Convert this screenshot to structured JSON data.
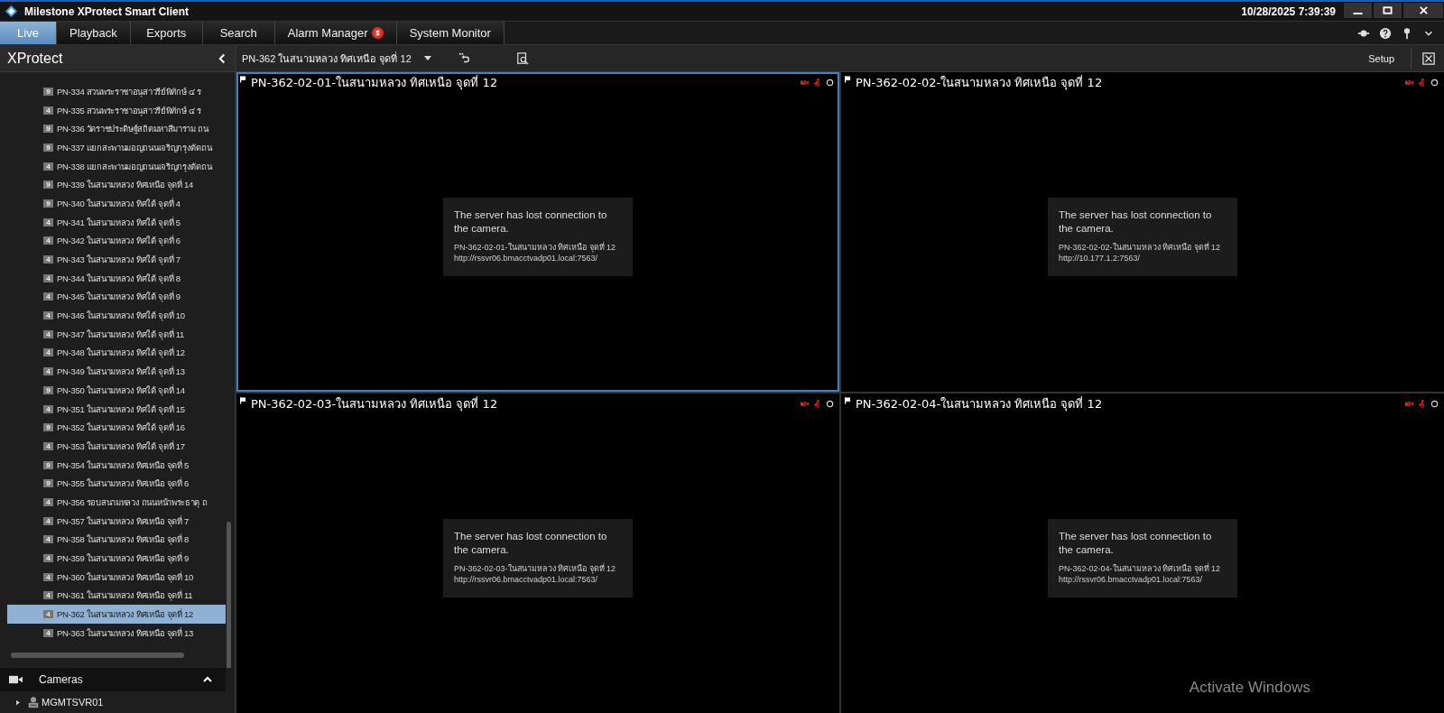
{
  "window": {
    "title": "Milestone XProtect Smart Client",
    "clock": "10/28/2025 7:39:39"
  },
  "tabs": [
    {
      "label": "Live",
      "selected": true,
      "alert": false
    },
    {
      "label": "Playback",
      "selected": false,
      "alert": false
    },
    {
      "label": "Exports",
      "selected": false,
      "alert": false
    },
    {
      "label": "Search",
      "selected": false,
      "alert": false
    },
    {
      "label": "Alarm Manager",
      "selected": false,
      "alert": true
    },
    {
      "label": "System Monitor",
      "selected": false,
      "alert": false
    }
  ],
  "sidebar": {
    "title": "XProtect",
    "items": [
      {
        "badge": "9",
        "label": "PN-334 สวนพระราชาอนุสาวรีย์พิทักษ์ ๔ ร",
        "selected": false
      },
      {
        "badge": "4",
        "label": "PN-335 สวนพระราชาอนุสาวรีย์พิทักษ์ ๔ ร",
        "selected": false
      },
      {
        "badge": "9",
        "label": "PN-336 วัดราชประดิษฐ์สถิตมหาสีมาราม ถน",
        "selected": false
      },
      {
        "badge": "9",
        "label": "PN-337 แยกสะพานมอญถนนเจริญกรุงตัดถน",
        "selected": false
      },
      {
        "badge": "4",
        "label": "PN-338 แยกสะพานมอญถนนเจริญกรุงตัดถน",
        "selected": false
      },
      {
        "badge": "9",
        "label": "PN-339 ในสนามหลวง ทิศเหนือ จุดที่ 14",
        "selected": false
      },
      {
        "badge": "9",
        "label": "PN-340 ในสนามหลวง ทิศใต้ จุดที่ 4",
        "selected": false
      },
      {
        "badge": "4",
        "label": "PN-341 ในสนามหลวง ทิศใต้ จุดที่ 5",
        "selected": false
      },
      {
        "badge": "4",
        "label": "PN-342 ในสนามหลวง ทิศใต้ จุดที่ 6",
        "selected": false
      },
      {
        "badge": "4",
        "label": "PN-343 ในสนามหลวง ทิศใต้ จุดที่ 7",
        "selected": false
      },
      {
        "badge": "4",
        "label": "PN-344 ในสนามหลวง ทิศใต้ จุดที่ 8",
        "selected": false
      },
      {
        "badge": "4",
        "label": "PN-345 ในสนามหลวง ทิศใต้ จุดที่ 9",
        "selected": false
      },
      {
        "badge": "4",
        "label": "PN-346 ในสนามหลวง ทิศใต้ จุดที่ 10",
        "selected": false
      },
      {
        "badge": "4",
        "label": "PN-347 ในสนามหลวง ทิศใต้ จุดที่ 11",
        "selected": false
      },
      {
        "badge": "4",
        "label": "PN-348 ในสนามหลวง ทิศใต้ จุดที่ 12",
        "selected": false
      },
      {
        "badge": "4",
        "label": "PN-349 ในสนามหลวง ทิศใต้ จุดที่ 13",
        "selected": false
      },
      {
        "badge": "9",
        "label": "PN-350 ในสนามหลวง ทิศใต้ จุดที่ 14",
        "selected": false
      },
      {
        "badge": "4",
        "label": "PN-351 ในสนามหลวง ทิศใต้ จุดที่ 15",
        "selected": false
      },
      {
        "badge": "9",
        "label": "PN-352 ในสนามหลวง ทิศใต้ จุดที่ 16",
        "selected": false
      },
      {
        "badge": "4",
        "label": "PN-353 ในสนามหลวง ทิศใต้ จุดที่ 17",
        "selected": false
      },
      {
        "badge": "9",
        "label": "PN-354 ในสนามหลวง ทิศเหนือ จุดที่ 5",
        "selected": false
      },
      {
        "badge": "9",
        "label": "PN-355 ในสนามหลวง ทิศเหนือ จุดที่ 6",
        "selected": false
      },
      {
        "badge": "4",
        "label": "PN-356 รอบสนามหลวง ถนนหน้าพระธาตุ ถ",
        "selected": false
      },
      {
        "badge": "4",
        "label": "PN-357 ในสนามหลวง ทิศเหนือ จุดที่ 7",
        "selected": false
      },
      {
        "badge": "4",
        "label": "PN-358 ในสนามหลวง ทิศเหนือ จุดที่ 8",
        "selected": false
      },
      {
        "badge": "4",
        "label": "PN-359 ในสนามหลวง ทิศเหนือ จุดที่ 9",
        "selected": false
      },
      {
        "badge": "4",
        "label": "PN-360 ในสนามหลวง ทิศเหนือ จุดที่ 10",
        "selected": false
      },
      {
        "badge": "4",
        "label": "PN-361 ในสนามหลวง ทิศเหนือ จุดที่ 11",
        "selected": false
      },
      {
        "badge": "4",
        "label": "PN-362 ในสนามหลวง ทิศเหนือ จุดที่ 12",
        "selected": true
      },
      {
        "badge": "4",
        "label": "PN-363 ในสนามหลวง ทิศเหนือ จุดที่ 13",
        "selected": false
      }
    ],
    "cameras_panel": {
      "title": "Cameras",
      "server": "MGMTSVR01"
    }
  },
  "toolbar": {
    "view": "PN-362 ในสนามหลวง ทิศเหนือ จุดที่ 12",
    "setup": "Setup"
  },
  "tiles": [
    {
      "title": "PN-362-02-01-ในสนามหลวง ทิศเหนือ จุดที่ 12",
      "selected": true,
      "message": "The server has lost connection to the camera.",
      "camera": "PN-362-02-01-ในสนามหลวง ทิศเหนือ จุดที่ 12",
      "url": "http://rssvr06.bmacctvadp01.local:7563/"
    },
    {
      "title": "PN-362-02-02-ในสนามหลวง ทิศเหนือ จุดที่ 12",
      "selected": false,
      "message": "The server has lost connection to the camera.",
      "camera": "PN-362-02-02-ในสนามหลวง ทิศเหนือ จุดที่ 12",
      "url": "http://10.177.1.2:7563/"
    },
    {
      "title": "PN-362-02-03-ในสนามหลวง ทิศเหนือ จุดที่ 12",
      "selected": false,
      "message": "The server has lost connection to the camera.",
      "camera": "PN-362-02-03-ในสนามหลวง ทิศเหนือ จุดที่ 12",
      "url": "http://rssvr06.bmacctvadp01.local:7563/"
    },
    {
      "title": "PN-362-02-04-ในสนามหลวง ทิศเหนือ จุดที่ 12",
      "selected": false,
      "message": "The server has lost connection to the camera.",
      "camera": "PN-362-02-04-ในสนามหลวง ทิศเหนือ จุดที่ 12",
      "url": "http://rssvr06.bmacctvadp01.local:7563/"
    }
  ],
  "watermark": {
    "text": "Activate Windows"
  }
}
